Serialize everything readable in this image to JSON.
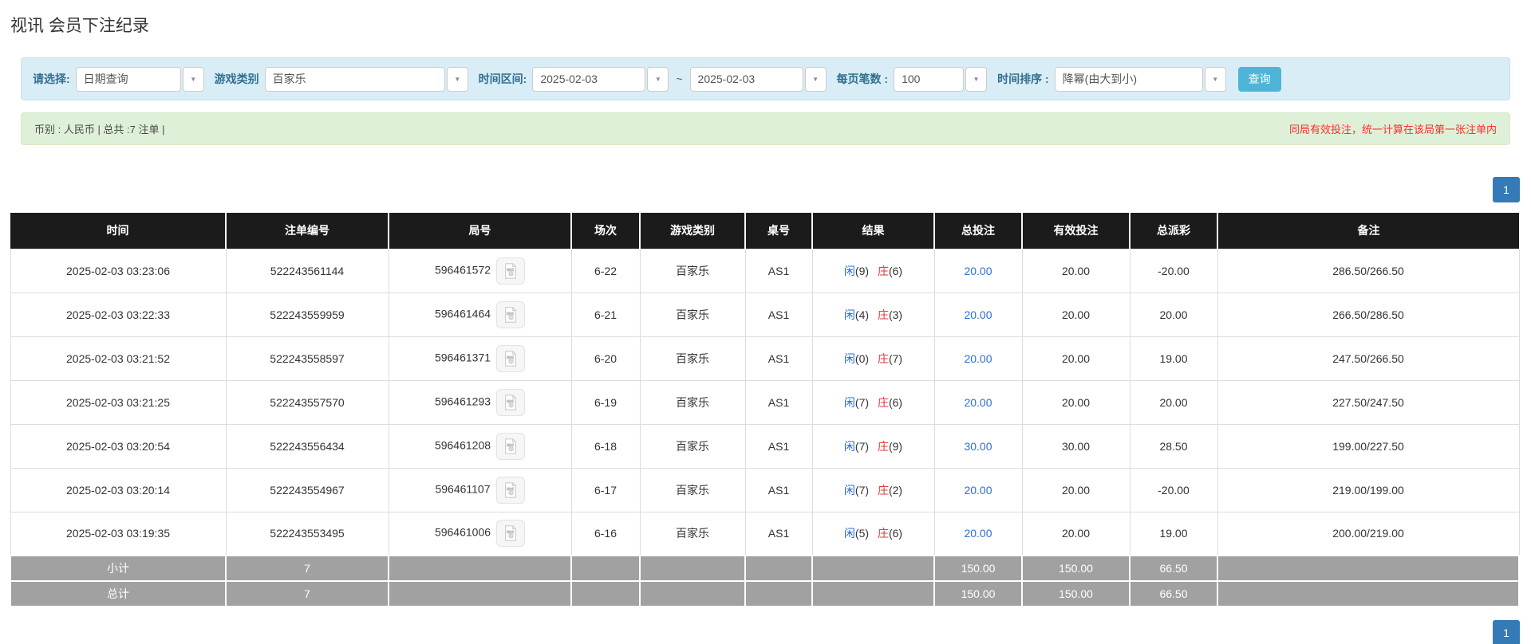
{
  "page_title": "视讯 会员下注纪录",
  "filter_bar": {
    "select": {
      "label": "请选择:",
      "value": "日期查询"
    },
    "game_type": {
      "label": "游戏类别",
      "value": "百家乐"
    },
    "date_range": {
      "label": "时间区间:",
      "from": "2025-02-03",
      "separator": "~",
      "to": "2025-02-03"
    },
    "page_size": {
      "label": "每页笔数 :",
      "value": "100"
    },
    "time_sort": {
      "label": "时间排序 :",
      "value": "降幂(由大到小)"
    },
    "search_button": "查询"
  },
  "info_bar": {
    "left": "币别 : 人民币 | 总共 :7 注单 |",
    "right": "同局有效投注，统一计算在该局第一张注单内"
  },
  "pagination": {
    "page": "1"
  },
  "table": {
    "headers": [
      "时间",
      "注单编号",
      "局号",
      "场次",
      "游戏类别",
      "桌号",
      "结果",
      "总投注",
      "有效投注",
      "总派彩",
      "备注"
    ],
    "rows": [
      {
        "time": "2025-02-03 03:23:06",
        "bet_id": "522243561144",
        "round_id": "596461572",
        "session": "6-22",
        "game": "百家乐",
        "table_no": "AS1",
        "result": {
          "player_label": "闲",
          "player_num": "(9)",
          "banker_label": "庄",
          "banker_num": "(6)"
        },
        "total_bet": "20.00",
        "valid_bet": "20.00",
        "payout": "-20.00",
        "remark": "286.50/266.50"
      },
      {
        "time": "2025-02-03 03:22:33",
        "bet_id": "522243559959",
        "round_id": "596461464",
        "session": "6-21",
        "game": "百家乐",
        "table_no": "AS1",
        "result": {
          "player_label": "闲",
          "player_num": "(4)",
          "banker_label": "庄",
          "banker_num": "(3)"
        },
        "total_bet": "20.00",
        "valid_bet": "20.00",
        "payout": "20.00",
        "remark": "266.50/286.50"
      },
      {
        "time": "2025-02-03 03:21:52",
        "bet_id": "522243558597",
        "round_id": "596461371",
        "session": "6-20",
        "game": "百家乐",
        "table_no": "AS1",
        "result": {
          "player_label": "闲",
          "player_num": "(0)",
          "banker_label": "庄",
          "banker_num": "(7)"
        },
        "total_bet": "20.00",
        "valid_bet": "20.00",
        "payout": "19.00",
        "remark": "247.50/266.50"
      },
      {
        "time": "2025-02-03 03:21:25",
        "bet_id": "522243557570",
        "round_id": "596461293",
        "session": "6-19",
        "game": "百家乐",
        "table_no": "AS1",
        "result": {
          "player_label": "闲",
          "player_num": "(7)",
          "banker_label": "庄",
          "banker_num": "(6)"
        },
        "total_bet": "20.00",
        "valid_bet": "20.00",
        "payout": "20.00",
        "remark": "227.50/247.50"
      },
      {
        "time": "2025-02-03 03:20:54",
        "bet_id": "522243556434",
        "round_id": "596461208",
        "session": "6-18",
        "game": "百家乐",
        "table_no": "AS1",
        "result": {
          "player_label": "闲",
          "player_num": "(7)",
          "banker_label": "庄",
          "banker_num": "(9)"
        },
        "total_bet": "30.00",
        "valid_bet": "30.00",
        "payout": "28.50",
        "remark": "199.00/227.50"
      },
      {
        "time": "2025-02-03 03:20:14",
        "bet_id": "522243554967",
        "round_id": "596461107",
        "session": "6-17",
        "game": "百家乐",
        "table_no": "AS1",
        "result": {
          "player_label": "闲",
          "player_num": "(7)",
          "banker_label": "庄",
          "banker_num": "(2)"
        },
        "total_bet": "20.00",
        "valid_bet": "20.00",
        "payout": "-20.00",
        "remark": "219.00/199.00"
      },
      {
        "time": "2025-02-03 03:19:35",
        "bet_id": "522243553495",
        "round_id": "596461006",
        "session": "6-16",
        "game": "百家乐",
        "table_no": "AS1",
        "result": {
          "player_label": "闲",
          "player_num": "(5)",
          "banker_label": "庄",
          "banker_num": "(6)"
        },
        "total_bet": "20.00",
        "valid_bet": "20.00",
        "payout": "19.00",
        "remark": "200.00/219.00"
      }
    ],
    "footer": [
      {
        "label": "小计",
        "count": "7",
        "total_bet": "150.00",
        "valid_bet": "150.00",
        "payout": "66.50"
      },
      {
        "label": "总计",
        "count": "7",
        "total_bet": "150.00",
        "valid_bet": "150.00",
        "payout": "66.50"
      }
    ]
  },
  "colors": {
    "accent_blue_link": "#2a6fdb",
    "player_blue": "#2668d9",
    "banker_red": "#e23b3b",
    "negative_red": "#e60000",
    "search_button_bg": "#4eb5d8",
    "pagination_active_bg": "#337ab7",
    "filter_panel_bg": "#d9edf7",
    "info_bar_bg": "#dff0d8",
    "info_bar_warning_text": "#ff2d2d",
    "table_header_bg": "#1b1b1b",
    "table_footer_bg": "#a1a1a1"
  }
}
